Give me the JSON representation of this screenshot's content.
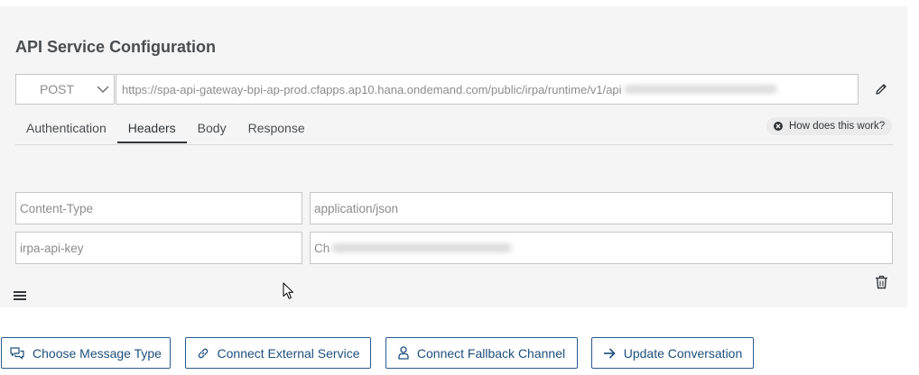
{
  "config": {
    "title": "API Service Configuration",
    "method": "POST",
    "url": "https://spa-api-gateway-bpi-ap-prod.cfapps.ap10.hana.ondemand.com/public/irpa/runtime/v1/api"
  },
  "tabs": [
    {
      "label": "Authentication"
    },
    {
      "label": "Headers"
    },
    {
      "label": "Body"
    },
    {
      "label": "Response"
    }
  ],
  "active_tab": "Headers",
  "help": {
    "label": "How does this work?"
  },
  "headers": [
    {
      "key_placeholder": "Content-Type",
      "value_placeholder": "application/json"
    },
    {
      "key_placeholder": "irpa-api-key",
      "value_placeholder": "Ch"
    }
  ],
  "actions": {
    "choose_message_type": "Choose Message Type",
    "connect_external_service": "Connect External Service",
    "connect_fallback_channel": "Connect Fallback Channel",
    "update_conversation": "Update Conversation"
  },
  "colors": {
    "accent": "#1d4f7c",
    "panel_bg": "#f5f5f5",
    "border": "#c6c6c6"
  },
  "icons": {
    "method_dropdown": "chevron-down-icon",
    "edit": "pencil-icon",
    "help": "close-circle-icon",
    "delete": "trash-icon",
    "reorder": "hamburger-icon",
    "choose_message_type": "chat-bubbles-icon",
    "connect_external_service": "link-icon",
    "connect_fallback_channel": "person-icon",
    "update_conversation": "arrow-right-icon"
  }
}
